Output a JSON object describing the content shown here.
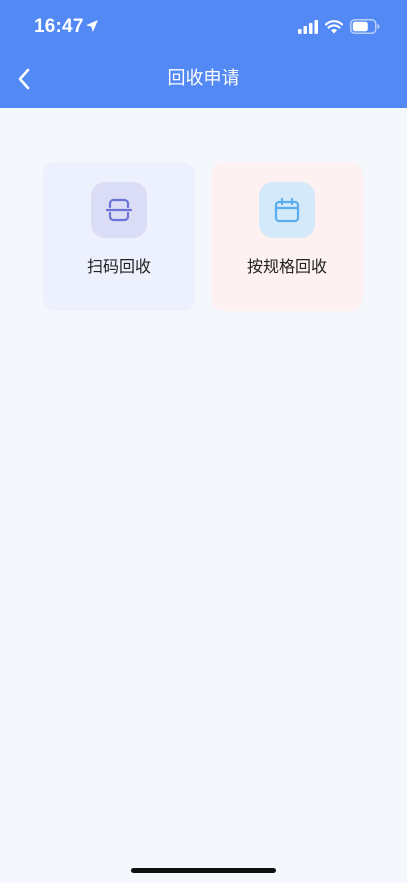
{
  "status_bar": {
    "time": "16:47"
  },
  "header": {
    "title": "回收申请",
    "background_color": "#5389f5"
  },
  "cards": [
    {
      "label": "扫码回收",
      "icon": "scan-icon",
      "background_color": "#edf1fd",
      "icon_color": "#6b72d8"
    },
    {
      "label": "按规格回收",
      "icon": "calendar-icon",
      "background_color": "#fdf1f1",
      "icon_color": "#5aaef0"
    }
  ]
}
